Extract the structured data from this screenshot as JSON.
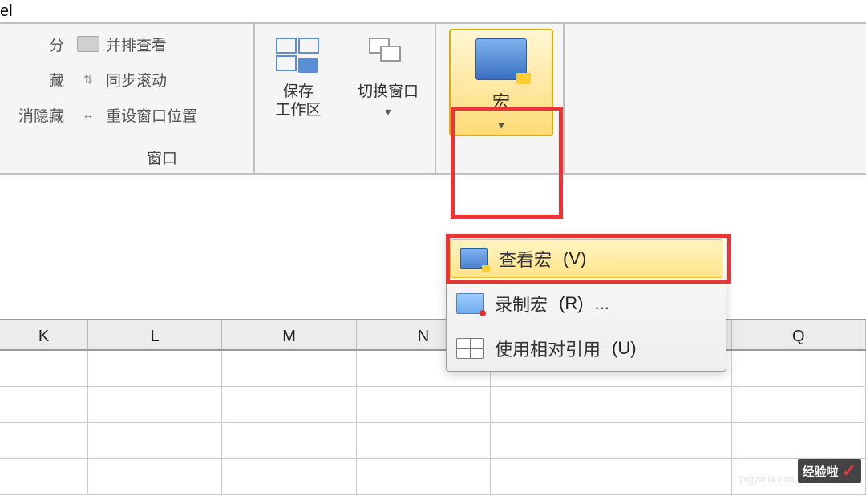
{
  "title": "el",
  "ribbon": {
    "left": {
      "split": "分",
      "hide": "藏",
      "cancel_hide": "消隐藏"
    },
    "window_group": {
      "side_by_side": "并排查看",
      "sync_scroll": "同步滚动",
      "reset_pos": "重设窗口位置",
      "label": "窗口"
    },
    "save_area": {
      "label": "保存\n工作区"
    },
    "switch_window": {
      "label": "切换窗口"
    },
    "macro": {
      "label": "宏"
    }
  },
  "macro_menu": {
    "view": {
      "label": "查看宏",
      "hotkey": "(V)"
    },
    "record": {
      "label": "录制宏",
      "hotkey": "(R)",
      "suffix": "..."
    },
    "relative": {
      "label": "使用相对引用",
      "hotkey": "(U)"
    }
  },
  "columns": [
    "K",
    "L",
    "M",
    "N",
    "",
    "Q"
  ],
  "watermark": {
    "text": "经验啦",
    "domain": "jingyanla.com"
  }
}
